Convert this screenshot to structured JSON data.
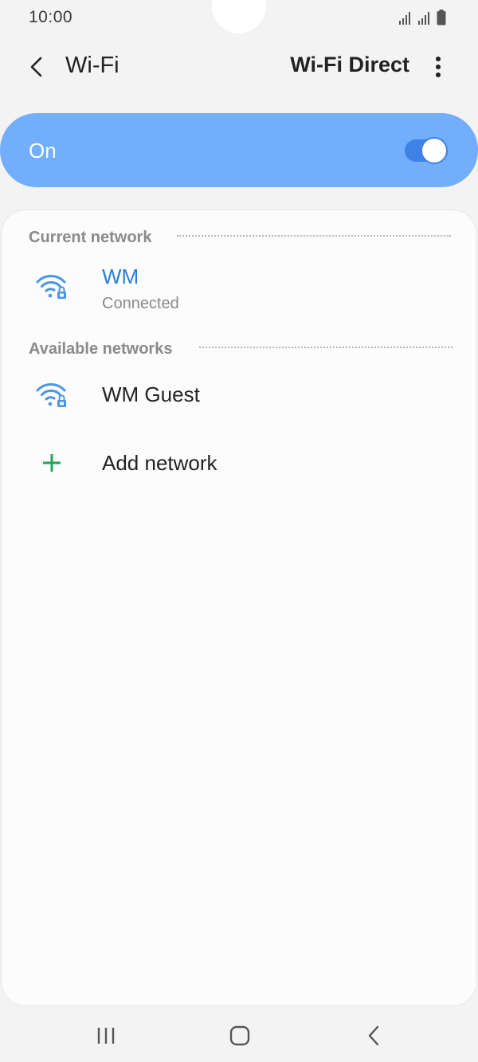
{
  "status_bar": {
    "time": "10:00"
  },
  "app_bar": {
    "title": "Wi-Fi",
    "wifi_direct_label": "Wi-Fi Direct"
  },
  "master_switch": {
    "label": "On",
    "state": true
  },
  "current_network": {
    "header": "Current network",
    "network": {
      "name": "WM",
      "status": "Connected",
      "icon": "wifi-lock-icon"
    }
  },
  "available_networks": {
    "header": "Available networks",
    "networks": [
      {
        "name": "WM Guest",
        "icon": "wifi-lock-icon"
      }
    ],
    "add_network_label": "Add network"
  },
  "colors": {
    "accent": "#72aefc",
    "accent_dark": "#3e82e8",
    "connected_text": "#2a7fd2",
    "add_icon": "#1fa65a",
    "wifi_icon": "#4a96e8"
  },
  "icons": {
    "back": "chevron-left-icon",
    "more": "more-vert-icon",
    "add": "plus-icon",
    "nav_recents": "recents-icon",
    "nav_home": "home-icon",
    "nav_back": "back-icon"
  }
}
